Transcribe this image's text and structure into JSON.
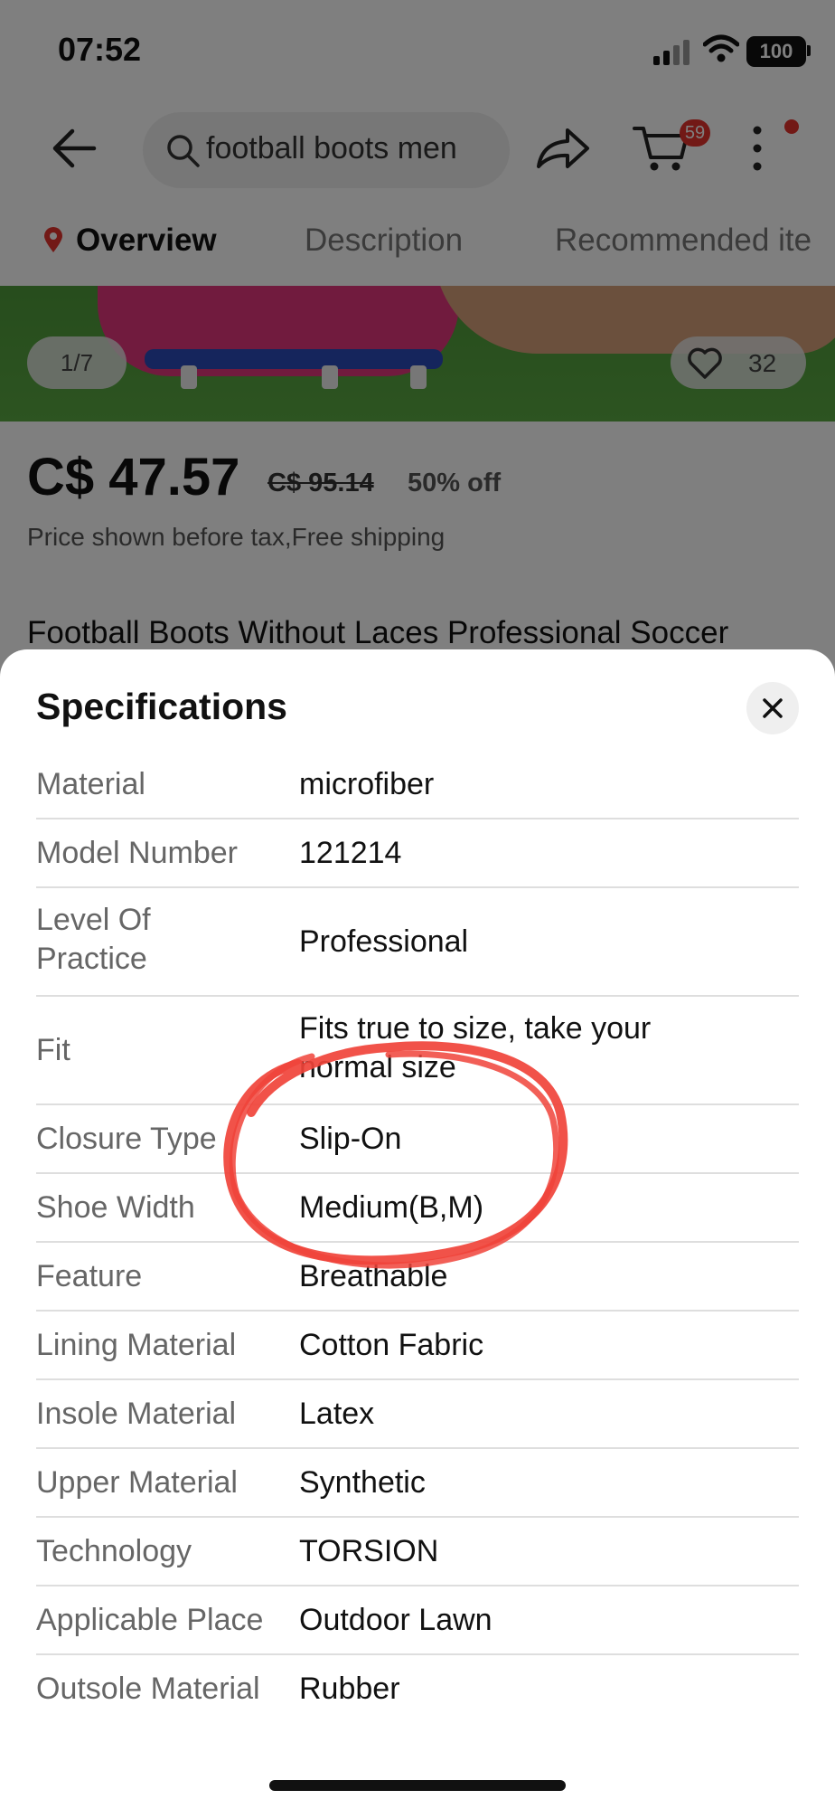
{
  "status_bar": {
    "time": "07:52",
    "battery": "100"
  },
  "nav": {
    "search_text": "football boots men",
    "cart_count": "59"
  },
  "tabs": [
    "Overview",
    "Description",
    "Recommended ite"
  ],
  "gallery": {
    "counter": "1/7",
    "likes": "32"
  },
  "product": {
    "price": "C$ 47.57",
    "old_price": "C$ 95.14",
    "discount": "50% off",
    "price_note": "Price shown before tax,Free shipping",
    "title": "Football Boots Without Laces Professional Soccer"
  },
  "sheet": {
    "title": "Specifications",
    "specs": [
      {
        "label": "Material",
        "value": "microfiber"
      },
      {
        "label": "Model Number",
        "value": "121214"
      },
      {
        "label": "Level Of Practice",
        "value": "Professional"
      },
      {
        "label": "Fit",
        "value": "Fits true to size, take your normal size"
      },
      {
        "label": "Closure Type",
        "value": "Slip-On"
      },
      {
        "label": "Shoe Width",
        "value": "Medium(B,M)"
      },
      {
        "label": "Feature",
        "value": "Breathable"
      },
      {
        "label": "Lining Material",
        "value": "Cotton Fabric"
      },
      {
        "label": "Insole Material",
        "value": "Latex"
      },
      {
        "label": "Upper Material",
        "value": "Synthetic"
      },
      {
        "label": "Technology",
        "value": "TORSION"
      },
      {
        "label": "Applicable Place",
        "value": "Outdoor Lawn"
      },
      {
        "label": "Outsole Material",
        "value": "Rubber"
      }
    ]
  },
  "colors": {
    "accent_red": "#e5322d",
    "annotation_red": "#f0433a"
  },
  "icons": [
    "back-arrow-icon",
    "search-icon",
    "share-icon",
    "cart-icon",
    "more-icon",
    "location-pin-icon",
    "heart-icon",
    "close-icon"
  ]
}
